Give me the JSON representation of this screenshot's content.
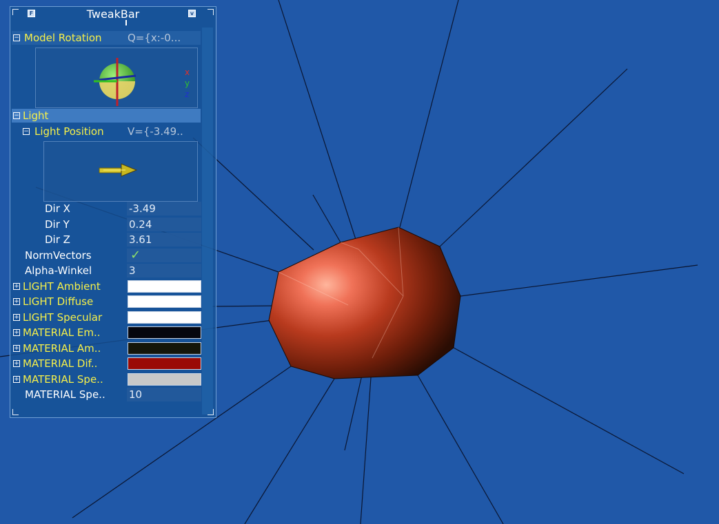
{
  "scene": {
    "background_color": "#2058a8",
    "object_color": "#8a2a12",
    "highlight_color": "#ff9a80",
    "line_color": "#0a1530"
  },
  "tweakbar": {
    "title": "TweakBar",
    "btn_f_label": "F",
    "btn_v_label": "v",
    "model_rotation": {
      "label": "Model Rotation",
      "value": "Q={x:-0...",
      "axes": {
        "x": "x",
        "y": "y",
        "z": "z"
      }
    },
    "light_group_label": "Light",
    "light_position": {
      "label": "Light Position",
      "value": "V={-3.49.."
    },
    "dir_x": {
      "label": "Dir X",
      "value": "-3.49"
    },
    "dir_y": {
      "label": "Dir Y",
      "value": "0.24"
    },
    "dir_z": {
      "label": "Dir Z",
      "value": "3.61"
    },
    "norm_vectors": {
      "label": "NormVectors",
      "value": "✓",
      "checked": true
    },
    "alpha_winkel": {
      "label": "Alpha-Winkel",
      "value": "3"
    },
    "light_ambient": {
      "label": "LIGHT Ambient",
      "color": "#ffffff"
    },
    "light_diffuse": {
      "label": "LIGHT Diffuse",
      "color": "#ffffff"
    },
    "light_specular": {
      "label": "LIGHT Specular",
      "color": "#ffffff"
    },
    "material_emission": {
      "label": "MATERIAL Em..",
      "color": "#05060e"
    },
    "material_ambient": {
      "label": "MATERIAL Am..",
      "color": "#15160a"
    },
    "material_diffuse": {
      "label": "MATERIAL Dif..",
      "color": "#9a0a05"
    },
    "material_specular": {
      "label": "MATERIAL Spe..",
      "color": "#c8c8c8"
    },
    "material_shininess": {
      "label": "MATERIAL Spe..",
      "value": "10"
    },
    "expand_symbol": "+",
    "collapse_symbol": "−"
  }
}
